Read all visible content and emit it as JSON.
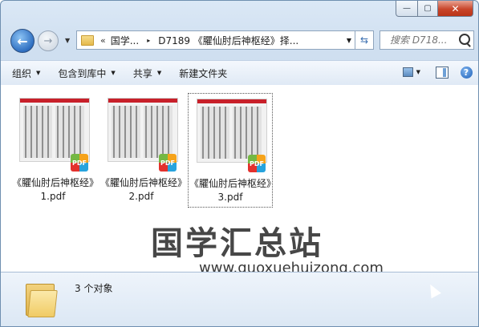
{
  "window": {
    "minimize_glyph": "—",
    "maximize_glyph": "▢",
    "close_glyph": "✕"
  },
  "nav": {
    "back_glyph": "←",
    "forward_glyph": "→",
    "address": {
      "prefix": "«",
      "crumbs": [
        "国学...",
        "D7189 《臞仙肘后神枢经》择..."
      ],
      "arrow": "▸"
    },
    "search_placeholder": "搜索 D718..."
  },
  "toolbar": {
    "organize": "组织",
    "include_library": "包含到库中",
    "share": "共享",
    "new_folder": "新建文件夹",
    "help": "?"
  },
  "files": [
    {
      "name": "《臞仙肘后神枢经》1.pdf",
      "selected": false
    },
    {
      "name": "《臞仙肘后神枢经》2.pdf",
      "selected": false
    },
    {
      "name": "《臞仙肘后神枢经》3.pdf",
      "selected": true
    }
  ],
  "pdf_badge": "PDF",
  "watermark": {
    "text": "国学汇总站",
    "url": "www.guoxuehuizong.com"
  },
  "status": {
    "count": "3 个对象"
  },
  "colors": {
    "accent": "#2f6fc1",
    "close": "#c9452a",
    "pdf_red": "#c8202a"
  }
}
